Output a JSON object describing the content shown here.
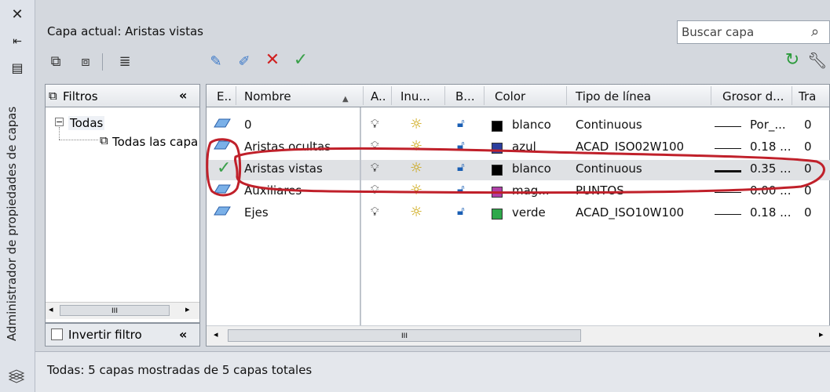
{
  "window": {
    "title": "Administrador de propiedades de capas"
  },
  "side_icons": [
    "close-icon",
    "auto-hide-icon",
    "properties-icon",
    "layers-icon"
  ],
  "header": {
    "current_layer_label": "Capa actual: Aristas vistas"
  },
  "search": {
    "placeholder": "Buscar capa"
  },
  "filters": {
    "header": "Filtros",
    "collapse": "«",
    "tree": [
      {
        "label": "Todas"
      },
      {
        "label": "Todas las capas usadas"
      }
    ],
    "invert_label": "Invertir filtro",
    "scroll_mark": "III"
  },
  "table": {
    "columns": [
      "E..",
      "Nombre",
      "A..",
      "Inu...",
      "B...",
      "Color",
      "Tipo de línea",
      "Grosor d...",
      "Tra"
    ],
    "rows": [
      {
        "status": "layer",
        "name": "0",
        "color_name": "blanco",
        "color": "#000000",
        "linetype": "Continuous",
        "lineweight": "Por_...",
        "trans": "0"
      },
      {
        "status": "layer",
        "name": "Aristas ocultas",
        "color_name": "azul",
        "color": "#2b3f9e",
        "linetype": "ACAD_ISO02W100",
        "lineweight": "0.18 ...",
        "trans": "0"
      },
      {
        "status": "current",
        "name": "Aristas vistas",
        "color_name": "blanco",
        "color": "#000000",
        "linetype": "Continuous",
        "lineweight": "0.35 ...",
        "trans": "0"
      },
      {
        "status": "layer",
        "name": "Auxiliares",
        "color_name": "mag...",
        "color": "#b040a8",
        "linetype": "PUNTOS",
        "lineweight": "0.00 ...",
        "trans": "0"
      },
      {
        "status": "layer",
        "name": "Ejes",
        "color_name": "verde",
        "color": "#2ea84a",
        "linetype": "ACAD_ISO10W100",
        "lineweight": "0.18 ...",
        "trans": "0"
      }
    ],
    "scroll_mark": "III"
  },
  "status_bar": {
    "text": "Todas: 5 capas mostradas de 5 capas totales"
  },
  "colors": {
    "annotation": "#c0202a",
    "check": "#3aa04a"
  }
}
